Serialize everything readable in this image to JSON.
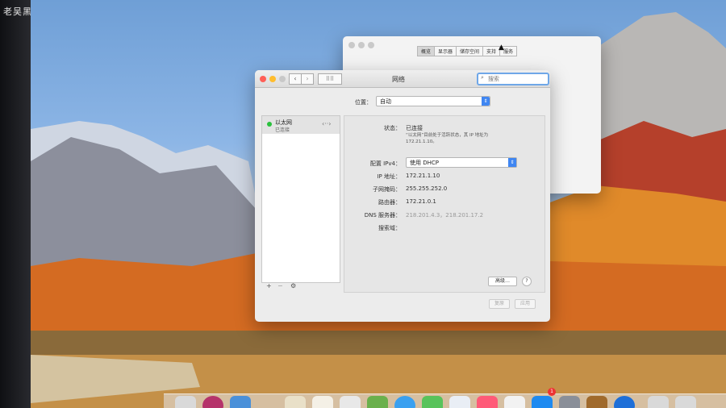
{
  "watermark": "老吴黑苹果工作室",
  "back_window": {
    "tabs": [
      "概览",
      "显示器",
      "储存空间",
      "支持",
      "服务"
    ],
    "selected_tab_index": 0
  },
  "network": {
    "title": "网络",
    "search_placeholder": "搜索",
    "location_label": "位置：",
    "location_value": "自动",
    "sidebar": {
      "items": [
        {
          "name": "以太网",
          "status": "已连接",
          "status_color": "#29c13c"
        }
      ],
      "add": "+",
      "remove": "−",
      "gear": "⚙"
    },
    "status_label": "状态：",
    "status_value": "已连接",
    "status_desc": "“以太网”目前处于活跃状态，其 IP 地址为 172.21.1.10。",
    "config_ipv4_label": "配置 IPv4：",
    "config_ipv4_value": "使用 DHCP",
    "ip_label": "IP 地址：",
    "ip_value": "172.21.1.10",
    "subnet_label": "子网掩码：",
    "subnet_value": "255.255.252.0",
    "router_label": "路由器：",
    "router_value": "172.21.0.1",
    "dns_label": "DNS 服务器：",
    "dns_value": "218.201.4.3，218.201.17.2",
    "search_domain_label": "搜索域：",
    "advanced_button": "高级…",
    "help_button": "?",
    "revert_button": "复原",
    "apply_button": "应用"
  },
  "dock": {
    "badge": "1"
  }
}
